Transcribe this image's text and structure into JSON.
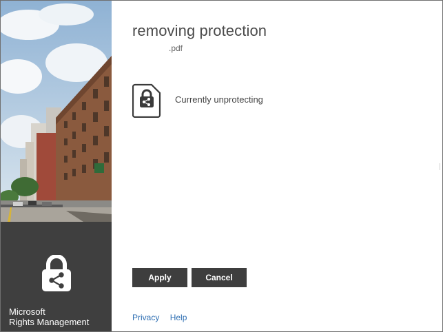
{
  "sidebar": {
    "brand_line1": "Microsoft",
    "brand_line2": "Rights Management",
    "lock_icon": "lock-share-icon",
    "hero_image": "city-street-photo"
  },
  "main": {
    "title": "removing protection",
    "filename": ".pdf",
    "status_text": "Currently unprotecting",
    "status_icon": "protected-document-icon"
  },
  "buttons": {
    "apply_label": "Apply",
    "cancel_label": "Cancel"
  },
  "footer": {
    "privacy_label": "Privacy",
    "help_label": "Help"
  },
  "colors": {
    "sidebar_bg": "#3f3f3f",
    "button_bg": "#3e3e3e",
    "link": "#2f6fb3",
    "title": "#4a4a4a"
  }
}
